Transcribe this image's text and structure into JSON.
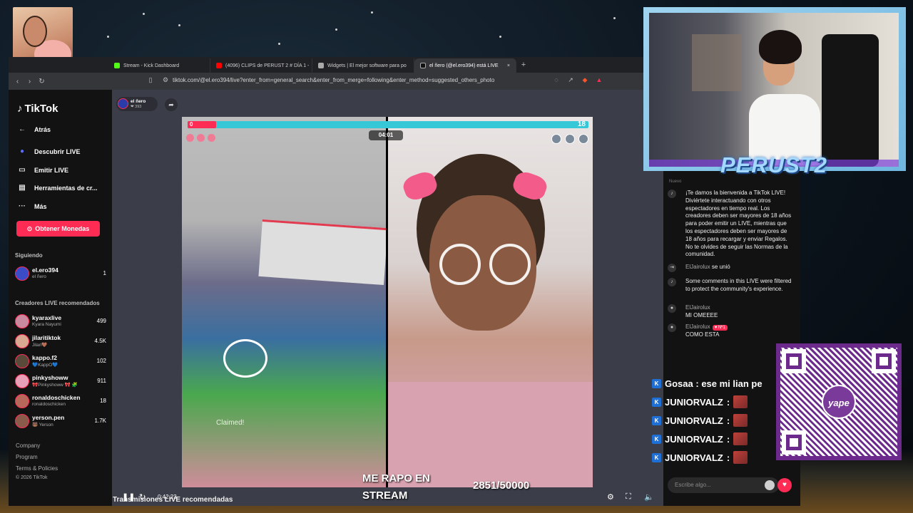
{
  "tabs": [
    {
      "label": "Stream - Kick Dashboard",
      "color": "#53fc18"
    },
    {
      "label": "(4096) CLIPS de PERUST 2 # DÍA 1 -",
      "color": "#ff0000"
    },
    {
      "label": "Widgets | El mejor software para po",
      "color": "#aaaaaa"
    },
    {
      "label": "el ñero (@el.ero394) está LIVE",
      "color": "#222222",
      "close": "×"
    }
  ],
  "newtab": "+",
  "url": "tiktok.com/@el.ero394/live?enter_from=general_search&enter_from_merge=following&enter_method=suggested_others_photo",
  "sidebar": {
    "logo": "TikTok",
    "nav": [
      {
        "label": "Atrás",
        "icon": "←"
      },
      {
        "label": "Descubrir LIVE",
        "icon": "●"
      },
      {
        "label": "Emitir LIVE",
        "icon": "▭"
      },
      {
        "label": "Herramientas de cr...",
        "icon": "▤"
      },
      {
        "label": "Más",
        "icon": "···"
      }
    ],
    "coins_button": "Obtener Monedas",
    "following_heading": "Siguiendo",
    "following": [
      {
        "name": "el.ero394",
        "sub": "el ñero",
        "count": "1"
      }
    ],
    "recommended_heading": "Creadores LIVE recomendados",
    "recommended": [
      {
        "name": "kyaraxlive",
        "sub": "Kyara Nayumi",
        "count": "499"
      },
      {
        "name": "jilaritiktok",
        "sub": "Jilari🤎",
        "count": "4.5K"
      },
      {
        "name": "kappo.f2",
        "sub": "💙KappO💙",
        "count": "102"
      },
      {
        "name": "pinkyshoww",
        "sub": "🎀Pinkyshoww 🎀 🧩",
        "count": "911"
      },
      {
        "name": "ronaldoschicken",
        "sub": "ronaldoschicken",
        "count": "18"
      },
      {
        "name": "yerson.pen",
        "sub": "🐻 Yerson",
        "count": "1.7K"
      }
    ],
    "footer": [
      "Company",
      "Program",
      "Terms & Policies",
      "© 2026 TikTok"
    ]
  },
  "stream": {
    "host_name": "el ñero",
    "host_viewers": "❤ 393",
    "pk_left": "0",
    "pk_right": "18",
    "timer": "04:01",
    "claimed_text": "Claimed!",
    "elapsed": "0:42:23",
    "recommended_title": "Transmisiones LIVE recomendadas"
  },
  "chat": {
    "header": "Nuevo",
    "messages": [
      {
        "icon": "♪",
        "name": "",
        "text": "¡Te damos la bienvenida a TikTok LIVE! Diviértete interactuando con otros espectadores en tiempo real. Los creadores deben ser mayores de 18 años para poder emitir un LIVE, mientras que los espectadores deben ser mayores de 18 años para recargar y enviar Regalos. No te olvides de seguir las Normas de la comunidad."
      },
      {
        "icon": "⇥",
        "name": "ElJairolux",
        "text": "se unió"
      },
      {
        "icon": "♪",
        "name": "",
        "text": "Some comments in this LIVE were filtered to protect the community's experience."
      },
      {
        "icon": "●",
        "name": "ElJairolux",
        "text": "MI OMEEEE"
      },
      {
        "icon": "●",
        "name": "ElJairolux",
        "badge": "♥ Nº1",
        "text": "COMO ESTA"
      }
    ],
    "input_placeholder": "Escribe algo..."
  },
  "overlay": {
    "brand": "PERUST2",
    "kick_chat": [
      {
        "user": "Gosaa",
        "text": ": ese mi lian pe"
      },
      {
        "user": "JUNIORVALZ",
        "text": ":"
      },
      {
        "user": "JUNIORVALZ",
        "text": ":"
      },
      {
        "user": "JUNIORVALZ",
        "text": ":"
      },
      {
        "user": "JUNIORVALZ",
        "text": ":"
      }
    ],
    "alert_title": "ME RAPO EN STREAM",
    "goal": "2851/50000",
    "qr_brand": "yape"
  }
}
